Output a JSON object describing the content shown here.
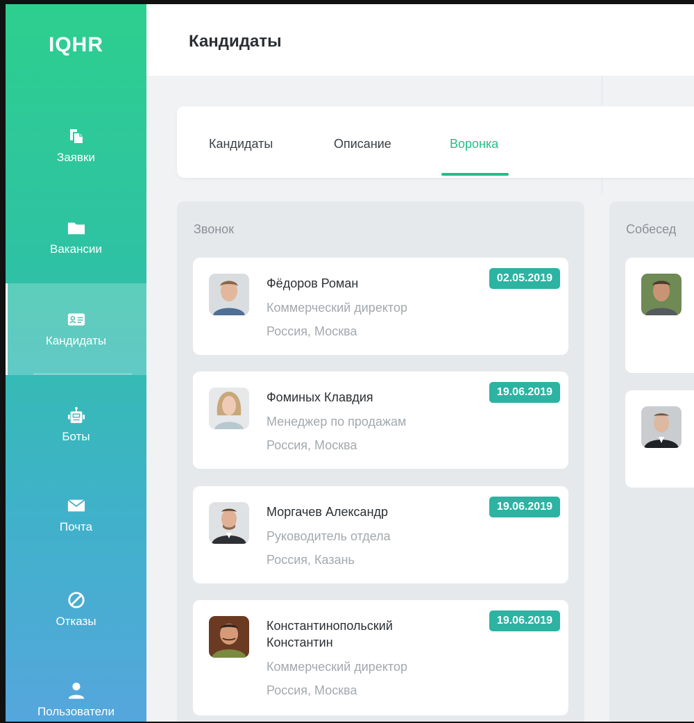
{
  "app": {
    "logo": "IQHR"
  },
  "sidebar": {
    "items": [
      {
        "label": "Заявки",
        "icon": "document-icon"
      },
      {
        "label": "Вакансии",
        "icon": "folder-icon"
      },
      {
        "label": "Кандидаты",
        "icon": "id-card-icon",
        "active": true
      },
      {
        "label": "Боты",
        "icon": "robot-icon"
      },
      {
        "label": "Почта",
        "icon": "envelope-icon"
      },
      {
        "label": "Отказы",
        "icon": "ban-icon"
      },
      {
        "label": "Пользователи",
        "icon": "user-icon"
      }
    ]
  },
  "header": {
    "title": "Кандидаты"
  },
  "tabs": [
    {
      "label": "Кандидаты"
    },
    {
      "label": "Описание"
    },
    {
      "label": "Воронка",
      "active": true
    }
  ],
  "columns": [
    {
      "title": "Звонок",
      "cards": [
        {
          "name": "Фёдоров Роман",
          "role": "Коммерческий директор",
          "location": "Россия, Москва",
          "date": "02.05.2019"
        },
        {
          "name": "Фоминых Клавдия",
          "role": "Менеджер по продажам",
          "location": "Россия, Москва",
          "date": "19.06.2019"
        },
        {
          "name": "Моргачев Александр",
          "role": "Руководитель отдела",
          "location": "Россия, Казань",
          "date": "19.06.2019"
        },
        {
          "name_line1": "Константинопольский",
          "name_line2": "Константин",
          "role": "Коммерческий директор",
          "location": "Россия, Москва",
          "date": "19.06.2019"
        }
      ]
    },
    {
      "title": "Собесед"
    }
  ],
  "colors": {
    "accent": "#1fbf8a",
    "date_badge": "#2cb3a2",
    "sidebar_top": "#2dcf8e",
    "sidebar_bottom": "#55a6dc"
  }
}
